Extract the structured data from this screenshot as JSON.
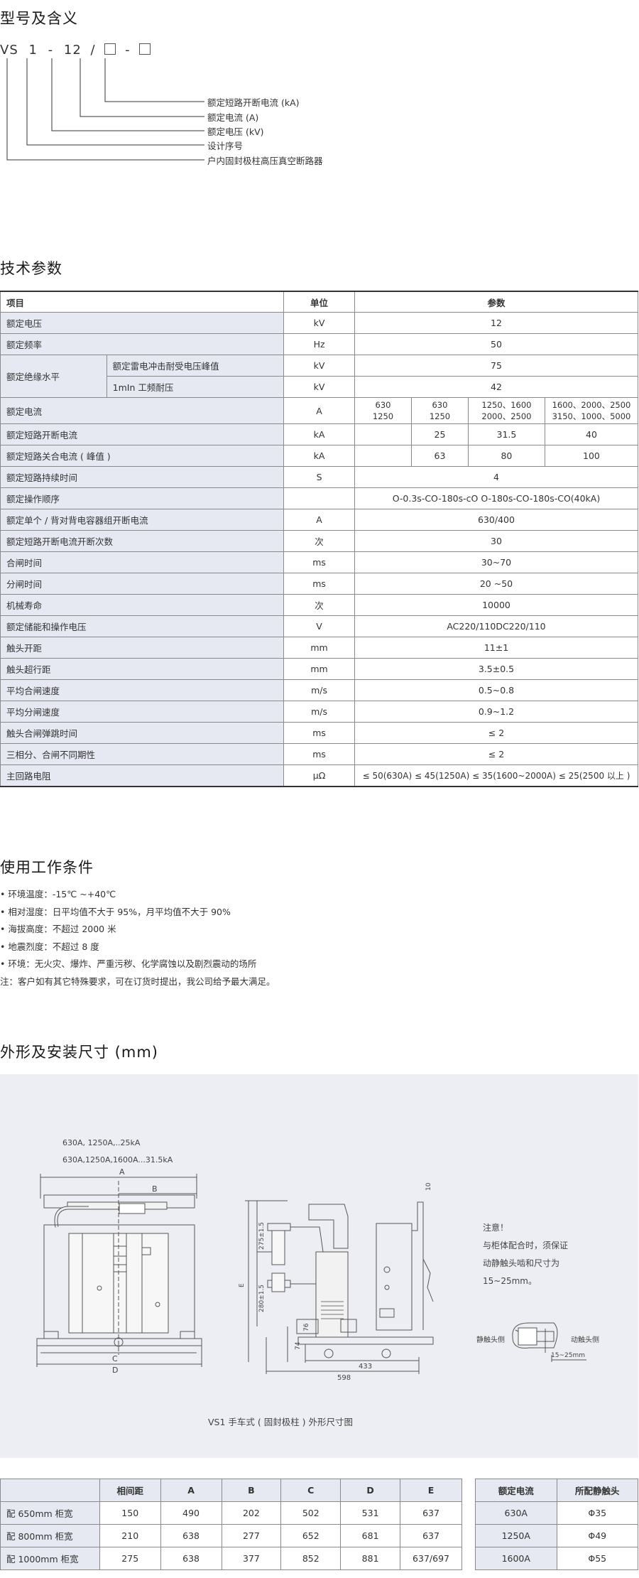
{
  "model": {
    "title": "型号及含义",
    "code": [
      "VS",
      "1",
      "-",
      "12",
      "/",
      "-"
    ],
    "labels": [
      "额定短路开断电流 (kA)",
      "额定电流 (A)",
      "额定电压 (kV)",
      "设计序号",
      "户内固封极柱高压真空断路器"
    ]
  },
  "tech": {
    "title": "技术参数",
    "header": {
      "item": "项目",
      "unit": "单位",
      "param": "参数"
    },
    "rows": {
      "r1": {
        "item": "额定电压",
        "unit": "kV",
        "val": "12"
      },
      "r2": {
        "item": "额定频率",
        "unit": "Hz",
        "val": "50"
      },
      "r3": {
        "item": "额定绝缘水平",
        "sub1": "额定雷电冲击耐受电压峰值",
        "unit1": "kV",
        "val1": "75",
        "sub2": "1mIn 工频耐压",
        "unit2": "kV",
        "val2": "42"
      },
      "r4": {
        "item": "额定电流",
        "unit": "A",
        "v1a": "630",
        "v1b": "1250",
        "v2a": "630",
        "v2b": "1250",
        "v3a": "1250、1600",
        "v3b": "2000、2500",
        "v4a": "1600、2000、2500",
        "v4b": "3150、1000、5000"
      },
      "r5": {
        "item": "额定短路开断电流",
        "unit": "kA",
        "v2": "25",
        "v3": "31.5",
        "v4": "40"
      },
      "r6": {
        "item": "额定短路关合电流 ( 峰值 )",
        "unit": "kA",
        "v2": "63",
        "v3": "80",
        "v4": "100"
      },
      "r7": {
        "item": "额定短路持续时间",
        "unit": "S",
        "val": "4"
      },
      "r8": {
        "item": "额定操作顺序",
        "unit": "",
        "val": "O-0.3s-CO-180s-cO  O-180s-CO-180s-CO(40kA)"
      },
      "r9": {
        "item": "额定单个 / 背对背电容器组开断电流",
        "unit": "A",
        "val": "630/400"
      },
      "r10": {
        "item": "额定短路开断电流开断次数",
        "unit": "次",
        "val": "30"
      },
      "r11": {
        "item": "合闸时间",
        "unit": "ms",
        "val": "30~70"
      },
      "r12": {
        "item": "分闸时间",
        "unit": "ms",
        "val": "20 ~50"
      },
      "r13": {
        "item": "机械寿命",
        "unit": "次",
        "val": "10000"
      },
      "r14": {
        "item": "额定储能和操作电压",
        "unit": "V",
        "val": "AC220/110DC220/110"
      },
      "r15": {
        "item": "触头开距",
        "unit": "mm",
        "val": "11±1"
      },
      "r16": {
        "item": "触头超行距",
        "unit": "mm",
        "val": "3.5±0.5"
      },
      "r17": {
        "item": "平均合闸速度",
        "unit": "m/s",
        "val": "0.5~0.8"
      },
      "r18": {
        "item": "平均分闸速度",
        "unit": "m/s",
        "val": "0.9~1.2"
      },
      "r19": {
        "item": "触头合闸弹跳时间",
        "unit": "ms",
        "val": "≤ 2"
      },
      "r20": {
        "item": "三相分、合闸不同期性",
        "unit": "ms",
        "val": "≤ 2"
      },
      "r21": {
        "item": "主回路电阻",
        "unit": "μΩ",
        "val": "≤ 50(630A) ≤ 45(1250A) ≤ 35(1600~2000A) ≤ 25(2500 以上 )"
      }
    }
  },
  "conditions": {
    "title": "使用工作条件",
    "items": [
      "• 环境温度：-15℃ ~+40℃",
      "• 相对湿度：日平均值不大于 95%，月平均值不大于 90%",
      "• 海拔高度：不超过 2000 米",
      "• 地震烈度：不超过 8 度",
      "• 环境：无火灾、爆炸、严重污秽、化学腐蚀以及剧烈震动的场所"
    ],
    "note": "注：客户如有其它特殊要求，可在订货时提出，我公司给予最大满足。"
  },
  "drawing": {
    "title": "外形及安装尺寸 (mm)",
    "ratings1": "630A, 1250A,..25kA",
    "ratings2": "630A,1250A,1600A...31.5kA",
    "dimA": "A",
    "dimB": "B",
    "dimC": "C",
    "dimD": "D",
    "dimE": "E",
    "d275": "275±1.5",
    "d280": "280±1.5",
    "d74": "74",
    "d76": "76",
    "d10": "10",
    "d433": "433",
    "d598": "598",
    "note_title": "注意！",
    "note_l1": "与柜体配合时，须保证",
    "note_l2": "动静触头啮和尺寸为",
    "note_l3": "15~25mm。",
    "static_side": "静触头侧",
    "moving_side": "动触头侧",
    "engage": "15~25mm",
    "caption": "VS1 手车式 ( 固封极柱 ) 外形尺寸图"
  },
  "dims": {
    "headers": [
      "",
      "相间距",
      "A",
      "B",
      "C",
      "D",
      "E"
    ],
    "rows": [
      [
        "配 650mm 柜宽",
        "150",
        "490",
        "202",
        "502",
        "531",
        "637"
      ],
      [
        "配 800mm 柜宽",
        "210",
        "638",
        "277",
        "652",
        "681",
        "637"
      ],
      [
        "配 1000mm 柜宽",
        "275",
        "638",
        "377",
        "852",
        "881",
        "637/697"
      ]
    ]
  },
  "contacts": {
    "headers": [
      "额定电流",
      "所配静触头"
    ],
    "rows": [
      [
        "630A",
        "Φ35"
      ],
      [
        "1250A",
        "Φ49"
      ],
      [
        "1600A",
        "Φ55"
      ]
    ]
  }
}
